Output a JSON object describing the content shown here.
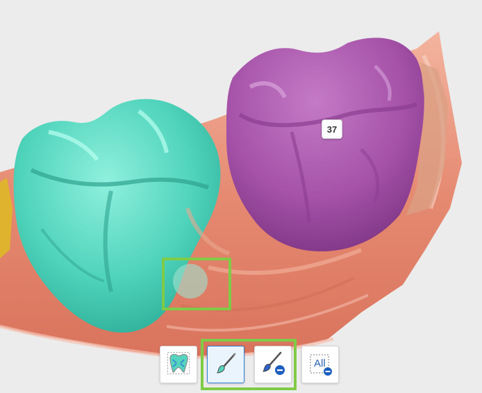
{
  "viewport": {
    "tooth_number_label": "37",
    "colors": {
      "background": "#ececec",
      "gum": "#e98a74",
      "segmented_tooth_teal": "#56d4be",
      "segmented_tooth_purple": "#a552a8",
      "highlight_green": "#7fcb47",
      "active_blue": "#2d7fd8"
    }
  },
  "toolbar": {
    "buttons": [
      {
        "icon": "auto-segment-tooth-icon",
        "active": false
      },
      {
        "icon": "paint-brush-add-icon",
        "active": true
      },
      {
        "icon": "paint-brush-erase-icon",
        "active": false
      },
      {
        "icon": "select-all-icon",
        "label": "All",
        "active": false
      }
    ]
  }
}
